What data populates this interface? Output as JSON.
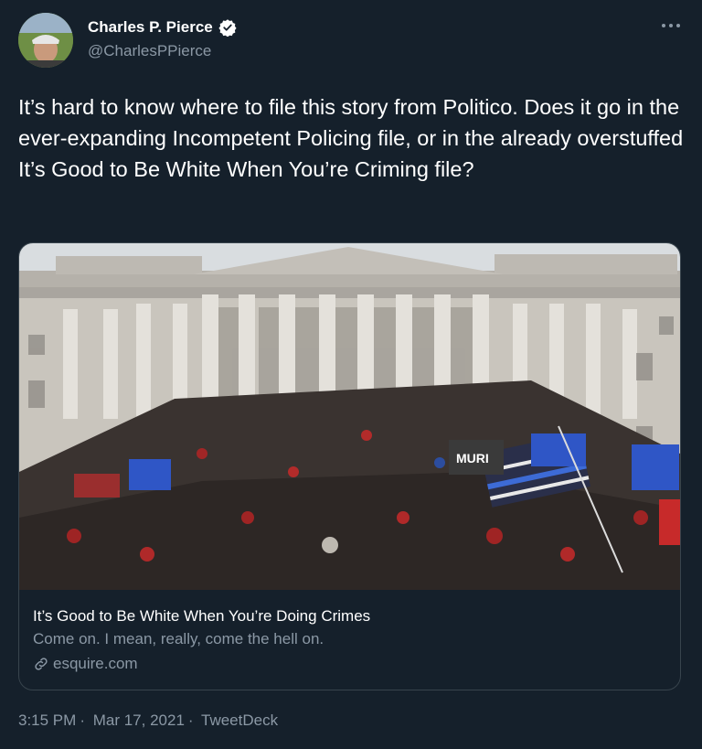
{
  "author": {
    "name": "Charles P. Pierce",
    "handle": "@CharlesPPierce"
  },
  "tweet": {
    "text": "It’s hard to know where to file this story from Politico. Does it go in the ever-expanding Incompetent Policing file, or in the already overstuffed It’s Good to Be White When You’re Criming file?"
  },
  "card": {
    "title": "It’s Good to Be White When You’re Doing Crimes",
    "description": "Come on. I mean, really, come the hell on.",
    "domain": "esquire.com",
    "image_sign_text": "MURI"
  },
  "meta": {
    "time": "3:15 PM",
    "date": "Mar 17, 2021",
    "source": "TweetDeck",
    "separator": "·"
  },
  "icons": {
    "verified": "verified-badge-icon",
    "more": "more-dots-icon",
    "link": "link-icon"
  },
  "colors": {
    "background": "#15202b",
    "secondary_text": "#8b98a5",
    "border": "#38444d"
  }
}
